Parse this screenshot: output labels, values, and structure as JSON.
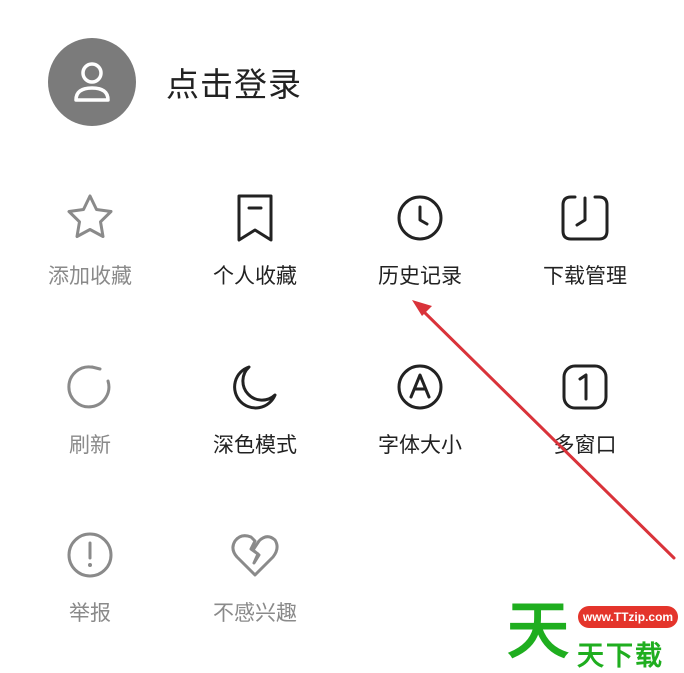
{
  "profile": {
    "login_label": "点击登录"
  },
  "menu": {
    "items": [
      {
        "label": "添加收藏",
        "icon": "star-icon"
      },
      {
        "label": "个人收藏",
        "icon": "bookmark-icon"
      },
      {
        "label": "历史记录",
        "icon": "clock-icon"
      },
      {
        "label": "下载管理",
        "icon": "download-clock-icon"
      },
      {
        "label": "刷新",
        "icon": "refresh-icon"
      },
      {
        "label": "深色模式",
        "icon": "moon-icon"
      },
      {
        "label": "字体大小",
        "icon": "font-size-icon"
      },
      {
        "label": "多窗口",
        "icon": "windows-icon"
      },
      {
        "label": "举报",
        "icon": "report-icon"
      },
      {
        "label": "不感兴趣",
        "icon": "broken-heart-icon"
      }
    ]
  },
  "watermark": {
    "url": "www.TTzip.com",
    "big": "天",
    "text": "天下载"
  },
  "colors": {
    "dark": "#222222",
    "dim": "#8a8a8a",
    "avatar": "#7b7b7b",
    "arrow": "#d9333a",
    "watermark_green": "#1fae1f"
  }
}
